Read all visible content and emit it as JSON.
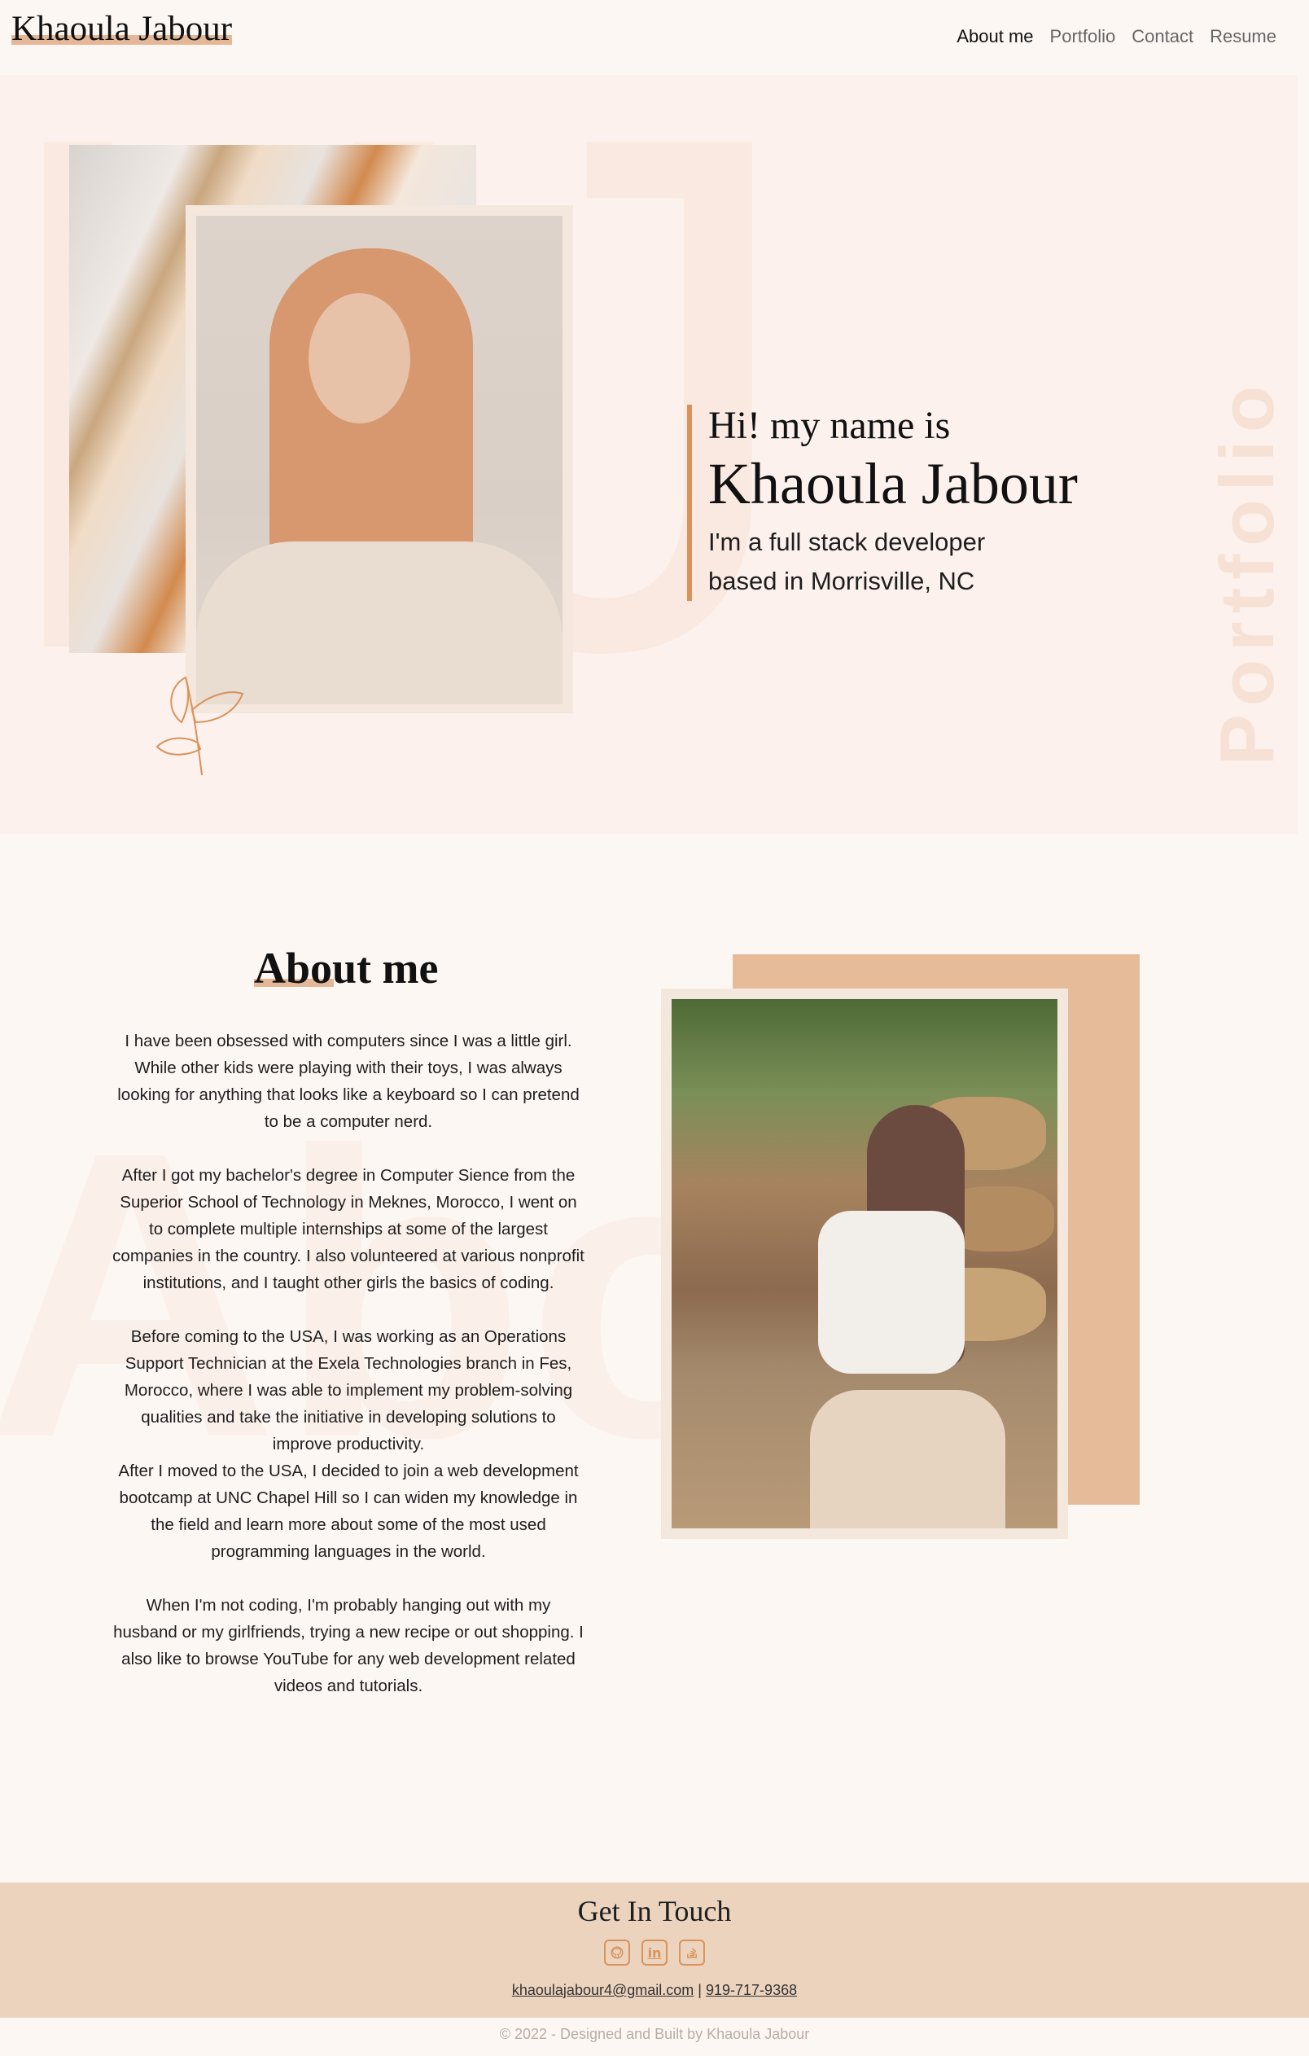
{
  "header": {
    "logo": "Khaoula Jabour",
    "nav": [
      {
        "label": "About me",
        "active": true
      },
      {
        "label": "Portfolio",
        "active": false
      },
      {
        "label": "Contact",
        "active": false
      },
      {
        "label": "Resume",
        "active": false
      }
    ]
  },
  "hero": {
    "greeting": "Hi! my name is",
    "name": "Khaoula Jabour",
    "role_line1": "I'm a full stack developer",
    "role_line2": "based in Morrisville, NC",
    "vertical_word": "Portfolio",
    "background_letters": "KJ"
  },
  "about": {
    "title": "About me",
    "background_letters": "Abo",
    "paragraphs": [
      "I have been obsessed with computers since I was a little girl. While other kids were playing with their toys, I was always looking for anything that looks like a keyboard so I can pretend to be a computer nerd.",
      "After I got my bachelor's degree in Computer Sience from the Superior School of Technology in Meknes, Morocco, I went on to complete multiple internships at some of the largest companies in the country. I also volunteered at various nonprofit institutions, and I taught other girls the basics of coding.",
      "Before coming to the USA, I was working as an Operations Support Technician at the Exela Technologies branch in Fes, Morocco, where I was able to implement my problem-solving qualities and take the initiative in developing solutions to improve productivity.",
      "After I moved to the USA, I decided to join a web development bootcamp at UNC Chapel Hill so I can widen my knowledge in the field and learn more about some of the most used programming languages in the world.",
      "When I'm not coding, I'm probably hanging out with my husband or my girlfriends, trying a new recipe or out shopping. I also like to browse YouTube for any web development related videos and tutorials."
    ]
  },
  "footer": {
    "title": "Get In Touch",
    "icons": [
      "github-icon",
      "linkedin-icon",
      "stackoverflow-icon"
    ],
    "email": "khaoulajabour4@gmail.com",
    "separator": "|",
    "phone": "919-717-9368",
    "copyright": "© 2022 - Designed and Built by Khaoula Jabour"
  },
  "colors": {
    "accent": "#d9925a",
    "hero_bg": "#fcf1ec",
    "page_bg": "#fdf7f4",
    "footer_bg": "#ebd3be",
    "tan_block": "#e6bb99"
  }
}
